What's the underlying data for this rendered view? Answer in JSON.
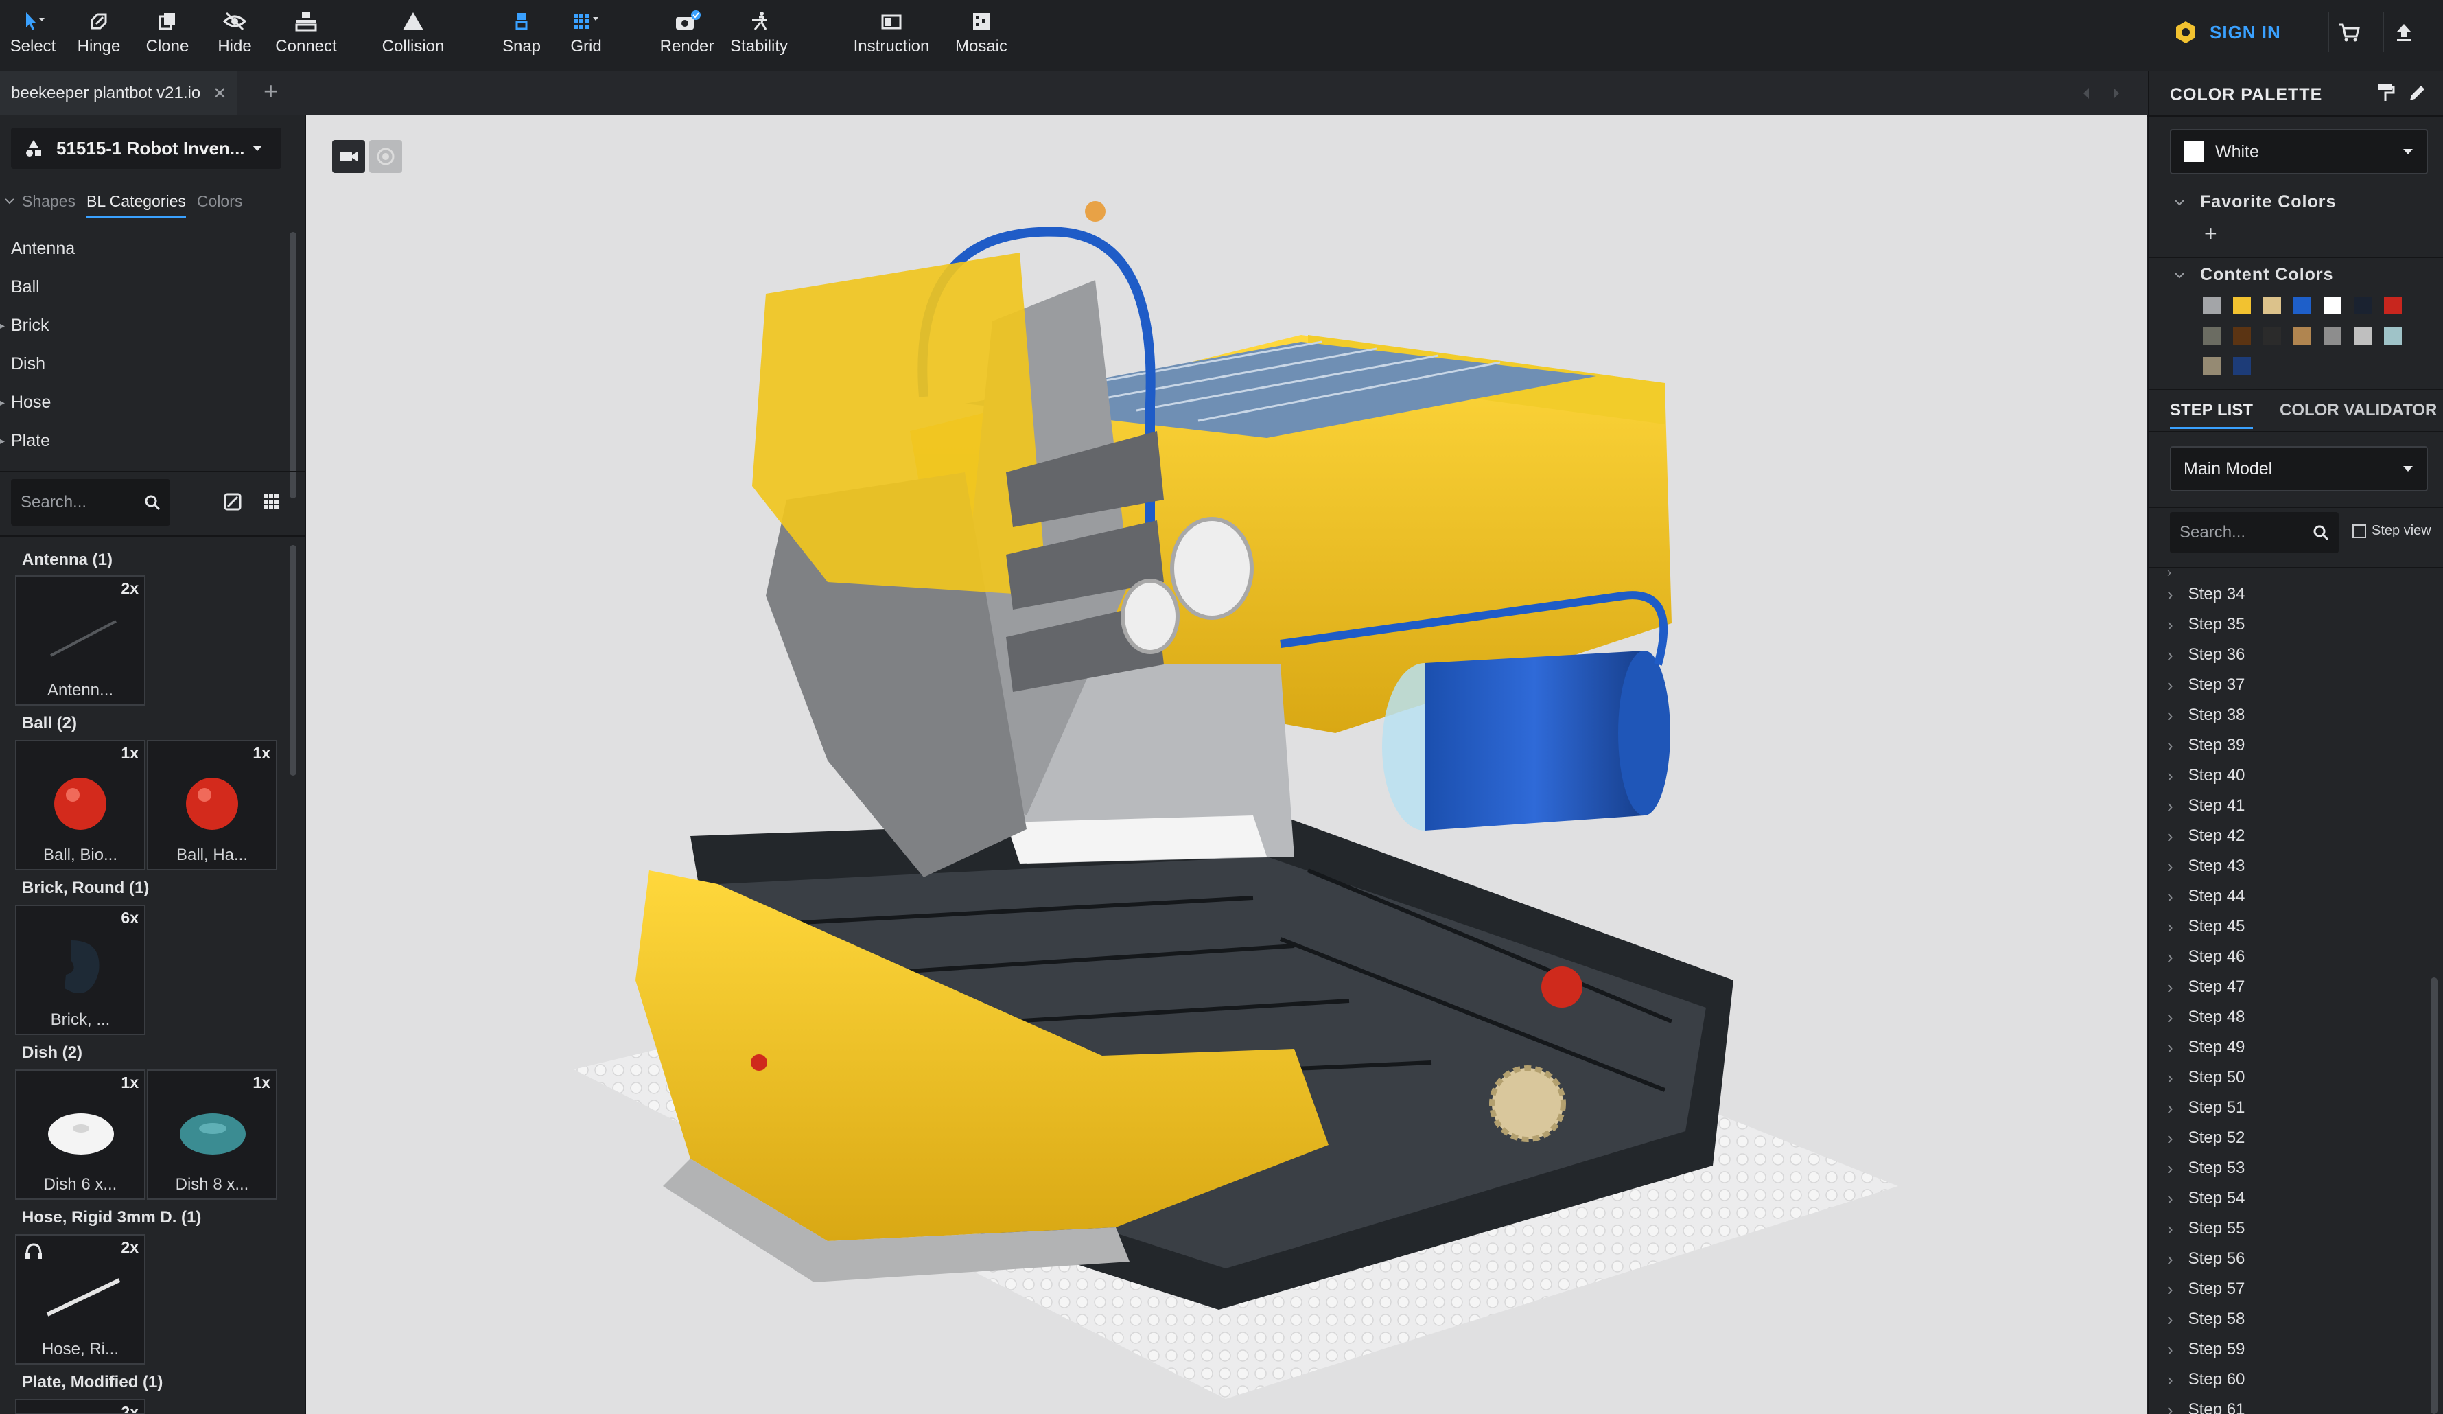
{
  "toolbar": {
    "tools": [
      {
        "label": "Select",
        "icon": "cursor-icon"
      },
      {
        "label": "Hinge",
        "icon": "hinge-icon"
      },
      {
        "label": "Clone",
        "icon": "clone-icon"
      },
      {
        "label": "Hide",
        "icon": "eye-slash-icon"
      },
      {
        "label": "Connect",
        "icon": "connect-icon"
      },
      {
        "label": "Collision",
        "icon": "warning-triangle-icon"
      },
      {
        "label": "Snap",
        "icon": "snap-icon"
      },
      {
        "label": "Grid",
        "icon": "grid-icon"
      },
      {
        "label": "Render",
        "icon": "camera-icon"
      },
      {
        "label": "Stability",
        "icon": "stability-icon"
      },
      {
        "label": "Instruction",
        "icon": "instruction-icon"
      },
      {
        "label": "Mosaic",
        "icon": "mosaic-icon"
      }
    ],
    "sign_in": "SIGN IN"
  },
  "tabbar": {
    "doc_tab": "beekeeper plantbot v21.io",
    "close": "✕",
    "add": "+"
  },
  "left": {
    "set_name": "51515-1 Robot Inven...",
    "tabs": [
      "Shapes",
      "BL Categories",
      "Colors"
    ],
    "categories": [
      "Antenna",
      "Ball",
      "Brick",
      "Dish",
      "Hose",
      "Plate"
    ],
    "search_placeholder": "Search...",
    "groups": [
      {
        "title": "Antenna (1)",
        "parts": [
          {
            "qty": "2x",
            "name": "Antenn..."
          }
        ]
      },
      {
        "title": "Ball (2)",
        "parts": [
          {
            "qty": "1x",
            "name": "Ball, Bio..."
          },
          {
            "qty": "1x",
            "name": "Ball, Ha..."
          }
        ]
      },
      {
        "title": "Brick, Round (1)",
        "parts": [
          {
            "qty": "6x",
            "name": "Brick, ..."
          }
        ]
      },
      {
        "title": "Dish (2)",
        "parts": [
          {
            "qty": "1x",
            "name": "Dish 6 x..."
          },
          {
            "qty": "1x",
            "name": "Dish 8 x..."
          }
        ]
      },
      {
        "title": "Hose, Rigid 3mm D. (1)",
        "parts": [
          {
            "qty": "2x",
            "name": "Hose, Ri..."
          }
        ]
      },
      {
        "title": "Plate, Modified (1)",
        "parts": [
          {
            "qty": "2x",
            "name": ""
          }
        ]
      }
    ]
  },
  "right": {
    "palette_title": "COLOR PALETTE",
    "selected_color": "White",
    "favorite_colors": "Favorite Colors",
    "content_colors": "Content Colors",
    "swatches": [
      "#a3a5a8",
      "#f2c230",
      "#dcc28b",
      "#1e5fc9",
      "#ffffff",
      "#1a2230",
      "#c8261e",
      "#6b6c62",
      "#5b3413",
      "#2b2b2b",
      "#b08550",
      "#8d8d8d",
      "#bfbfbf",
      "#9fc3c8",
      "#958a73",
      "#1d3c78"
    ],
    "tab_step_list": "STEP LIST",
    "tab_color_validator": "COLOR VALIDATOR",
    "model_select": "Main Model",
    "search_placeholder": "Search...",
    "step_view": "Step view",
    "steps": [
      "Step 34",
      "Step 35",
      "Step 36",
      "Step 37",
      "Step 38",
      "Step 39",
      "Step 40",
      "Step 41",
      "Step 42",
      "Step 43",
      "Step 44",
      "Step 45",
      "Step 46",
      "Step 47",
      "Step 48",
      "Step 49",
      "Step 50",
      "Step 51",
      "Step 52",
      "Step 53",
      "Step 54",
      "Step 55",
      "Step 56",
      "Step 57",
      "Step 58",
      "Step 59",
      "Step 60",
      "Step 61"
    ]
  },
  "colors": {
    "accent": "#3aa1ff",
    "toolbar_bg": "#1f2124",
    "viewport_bg": "#e0e0e1",
    "brick_yellow": "#f2c230"
  }
}
